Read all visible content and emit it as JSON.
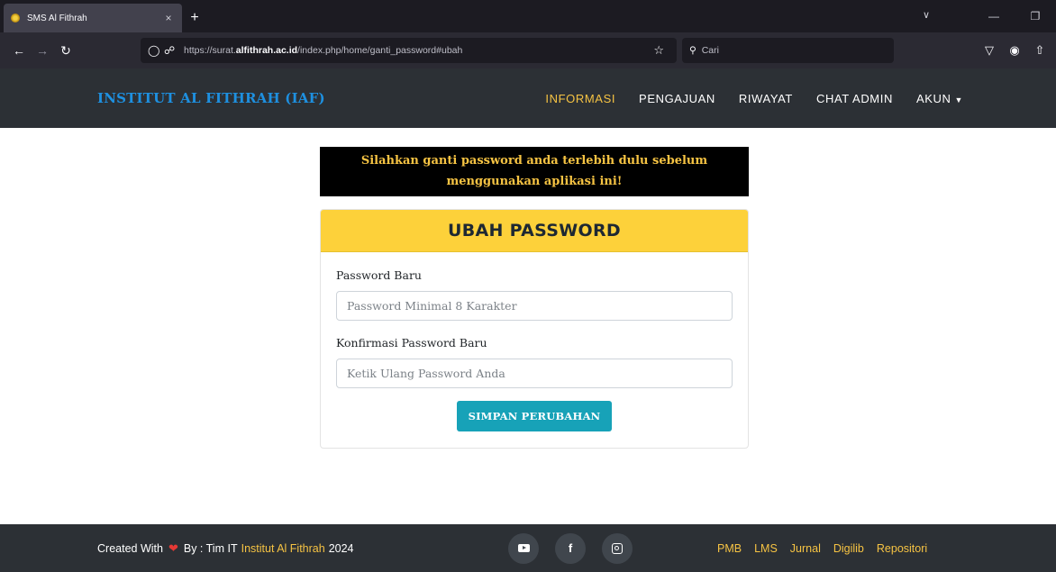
{
  "browser": {
    "tab_title": "SMS Al Fithrah",
    "tab_close": "×",
    "new_tab": "+",
    "url_prefix": "https://surat.",
    "url_domain": "alfithrah.ac.id",
    "url_path": "/index.php/home/ganti_password#ubah",
    "search_placeholder": "Cari"
  },
  "header": {
    "brand": "INSTITUT AL FITHRAH (IAF)",
    "nav": [
      {
        "label": "INFORMASI",
        "active": true
      },
      {
        "label": "PENGAJUAN"
      },
      {
        "label": "RIWAYAT"
      },
      {
        "label": "CHAT ADMIN"
      },
      {
        "label": "AKUN"
      }
    ]
  },
  "notice": {
    "line1": "Silahkan ganti password anda terlebih dulu sebelum",
    "line2": "menggunakan aplikasi ini!"
  },
  "form": {
    "title": "UBAH PASSWORD",
    "new_password_label": "Password Baru",
    "new_password_placeholder": "Password Minimal 8 Karakter",
    "confirm_label": "Konfirmasi Password Baru",
    "confirm_placeholder": "Ketik Ulang Password Anda",
    "submit_label": "SIMPAN PERUBAHAN"
  },
  "footer": {
    "created_with": "Created With",
    "by": "By : Tim IT",
    "org": "Institut Al Fithrah",
    "year": "2024",
    "social": [
      "youtube-icon",
      "facebook-icon",
      "instagram-icon"
    ],
    "links": [
      "PMB",
      "LMS",
      "Jurnal",
      "Digilib",
      "Repositori"
    ]
  },
  "colors": {
    "accent_yellow": "#f6c343",
    "header_bg": "#2c3035",
    "brand_blue": "#1e90e0",
    "card_header": "#fdd13a",
    "button": "#17a2b8"
  }
}
